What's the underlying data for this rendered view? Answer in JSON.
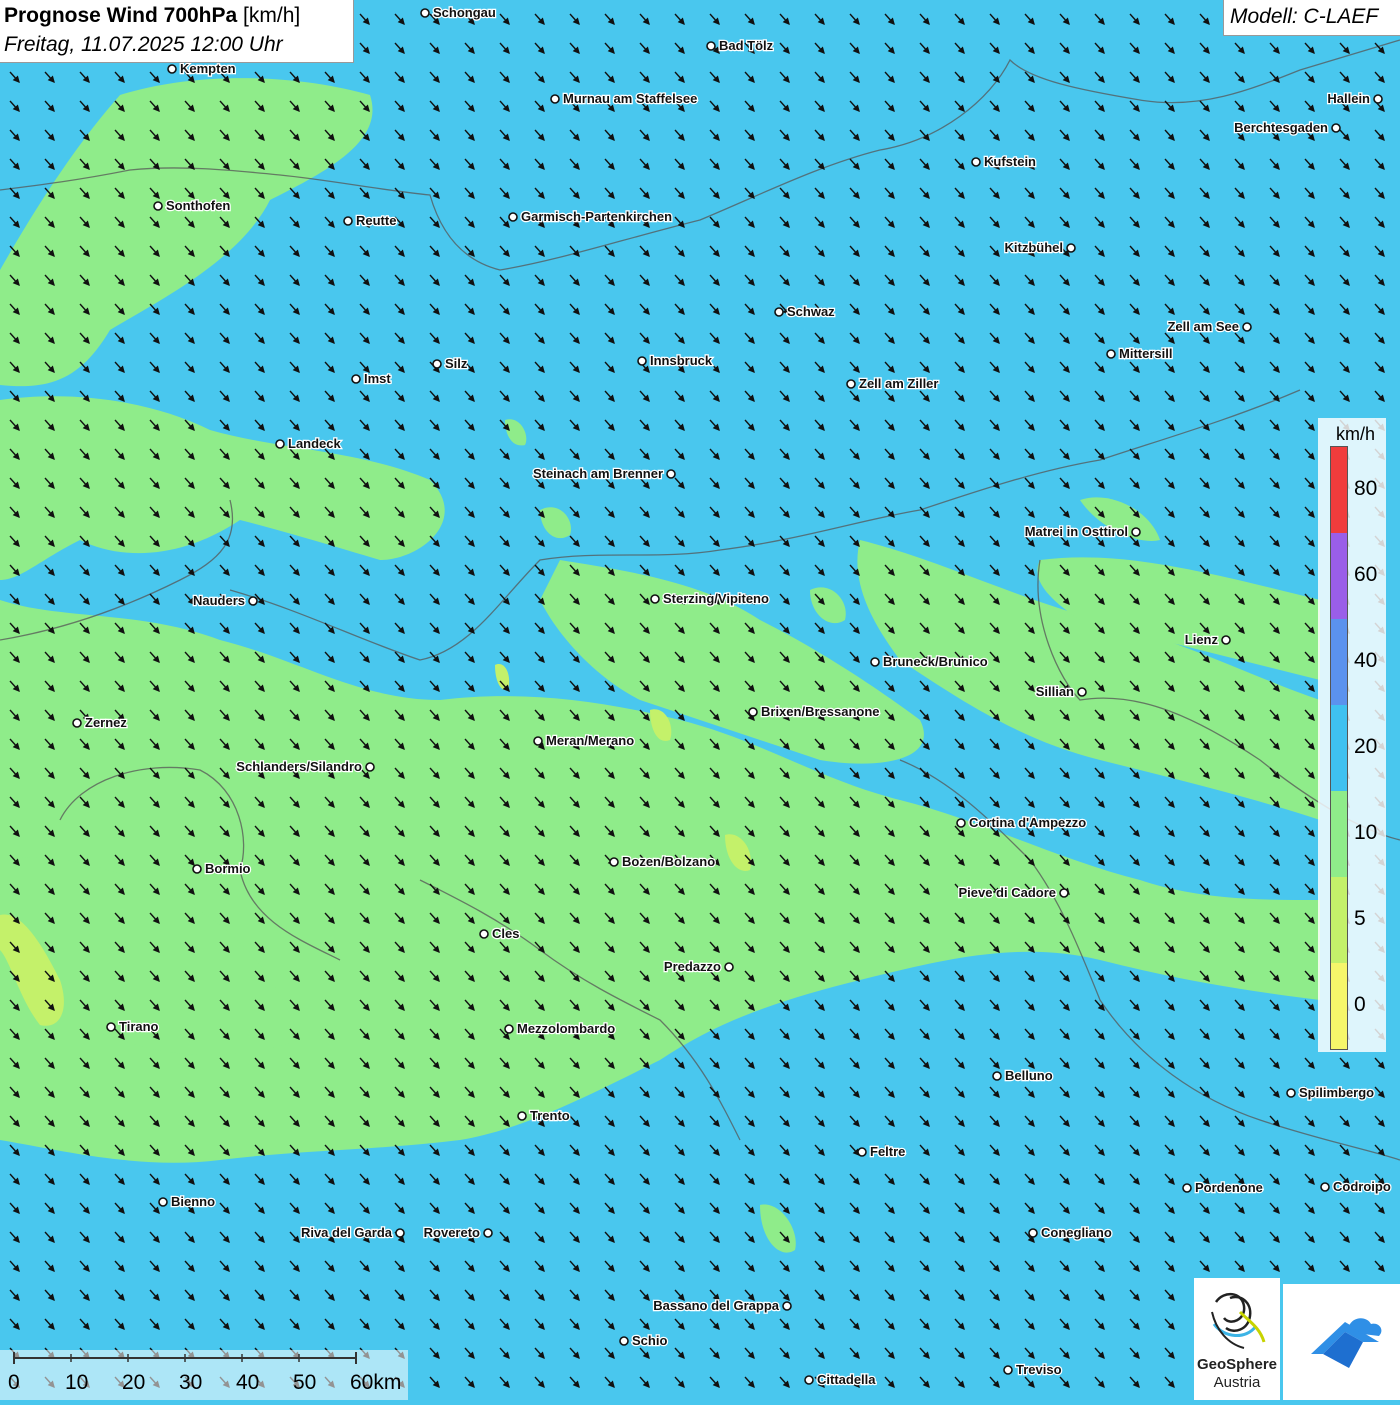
{
  "header": {
    "title_bold": "Prognose Wind 700hPa",
    "title_unit": "[km/h]",
    "datetime": "Freitag, 11.07.2025 12:00 Uhr",
    "model": "Modell: C-LAEF"
  },
  "legend": {
    "unit": "km/h",
    "bands": [
      {
        "from": 0,
        "to": 5,
        "color": "#f6f66a"
      },
      {
        "from": 5,
        "to": 10,
        "color": "#c4f16a"
      },
      {
        "from": 10,
        "to": 20,
        "color": "#8fec8a"
      },
      {
        "from": 20,
        "to": 40,
        "color": "#3fc1f0"
      },
      {
        "from": 40,
        "to": 60,
        "color": "#5b92ee"
      },
      {
        "from": 60,
        "to": 80,
        "color": "#9a5ee8"
      },
      {
        "from": 80,
        "to": 100,
        "color": "#f03c3c"
      }
    ],
    "ticks": [
      "0",
      "5",
      "10",
      "20",
      "40",
      "60",
      "80"
    ]
  },
  "scale_bar": {
    "labels": [
      "0",
      "10",
      "20",
      "30",
      "40",
      "50",
      "60km"
    ]
  },
  "logos": {
    "geosphere_line1": "GeoSphere",
    "geosphere_line2": "Austria",
    "geosphere_icon": "geosphere-swirl-icon",
    "weather_icon": "cloud-arrow-icon"
  },
  "cities": [
    {
      "name": "Schongau"
    },
    {
      "name": "Bad Tölz"
    },
    {
      "name": "Kempten"
    },
    {
      "name": "Murnau am Staffelsee"
    },
    {
      "name": "Hallein"
    },
    {
      "name": "Berchtesgaden"
    },
    {
      "name": "Kufstein"
    },
    {
      "name": "Sonthofen"
    },
    {
      "name": "Reutte"
    },
    {
      "name": "Garmisch-Partenkirchen"
    },
    {
      "name": "Kitzbühel"
    },
    {
      "name": "Schwaz"
    },
    {
      "name": "Zell am See"
    },
    {
      "name": "Mittersill"
    },
    {
      "name": "Innsbruck"
    },
    {
      "name": "Imst"
    },
    {
      "name": "Silz"
    },
    {
      "name": "Zell am Ziller"
    },
    {
      "name": "Landeck"
    },
    {
      "name": "Steinach am Brenner"
    },
    {
      "name": "Matrei in Osttirol"
    },
    {
      "name": "Nauders"
    },
    {
      "name": "Sterzing/Vipiteno"
    },
    {
      "name": "Lienz"
    },
    {
      "name": "Bruneck/Brunico"
    },
    {
      "name": "Sillian"
    },
    {
      "name": "Brixen/Bressanone"
    },
    {
      "name": "Zernez"
    },
    {
      "name": "Meran/Merano"
    },
    {
      "name": "Schlanders/Silandro"
    },
    {
      "name": "Cortina d'Ampezzo"
    },
    {
      "name": "Bozen/Bolzano"
    },
    {
      "name": "Bormio"
    },
    {
      "name": "Pieve di Cadore"
    },
    {
      "name": "Cles"
    },
    {
      "name": "Predazzo"
    },
    {
      "name": "Tirano"
    },
    {
      "name": "Mezzolombardo"
    },
    {
      "name": "Belluno"
    },
    {
      "name": "Spilimbergo"
    },
    {
      "name": "Trento"
    },
    {
      "name": "Feltre"
    },
    {
      "name": "Pordenone"
    },
    {
      "name": "Codroipo"
    },
    {
      "name": "Bienno"
    },
    {
      "name": "Riva del Garda"
    },
    {
      "name": "Rovereto"
    },
    {
      "name": "Conegliano"
    },
    {
      "name": "Bassano del Grappa"
    },
    {
      "name": "Schio"
    },
    {
      "name": "Treviso"
    },
    {
      "name": "Cittadella"
    }
  ],
  "wind": {
    "direction": "northwest",
    "field_colors": {
      "strong": "#49c7ee",
      "medium": "#8fec8a",
      "weak": "#c4f16a"
    }
  }
}
